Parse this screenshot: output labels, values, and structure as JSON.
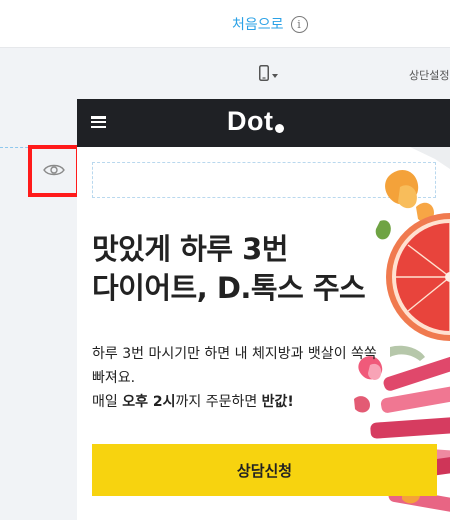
{
  "topbar": {
    "home_label": "처음으로",
    "info_icon": "info-icon",
    "info_glyph": "i"
  },
  "toolbar": {
    "device_icon": "mobile-phone-icon",
    "consult_settings_label": "상단설정"
  },
  "editor": {
    "visibility_icon": "eye-icon",
    "highlight_color": "#ff1a1a"
  },
  "site": {
    "menu_icon": "hamburger-menu-icon",
    "logo_text": "Dot",
    "header_color": "#1f2125",
    "hero": {
      "title_line1": "맛있게 하루 3번",
      "title_line2": "다이어트, D.톡스 주스",
      "description": "하루 3번 마시기만 하면 내 체지방과 뱃살이 쏙쏙 빠져요.",
      "note_prefix": "매일 ",
      "note_bold1": "오후 2시",
      "note_middle": "까지 주문하면 ",
      "note_bold2": "반값!"
    },
    "cta_label": "상담신청",
    "cta_color": "#f7d30f",
    "decor_image": "fruit-and-rhubarb-photo"
  }
}
